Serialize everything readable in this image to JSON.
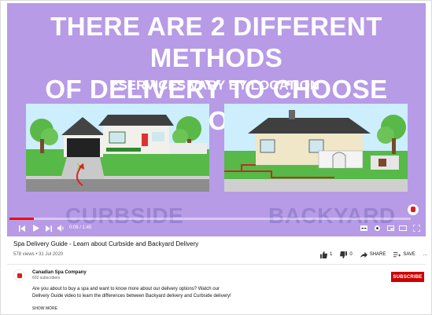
{
  "player": {
    "headline_line1": "THERE ARE 2 DIFFERENT METHODS",
    "headline_line2": "OF DELIVERY TO CHOOSE FROM:",
    "subline": "*SERVICES VARY BY LOCATION",
    "caption_left": "CURBSIDE",
    "caption_right": "BACKYARD",
    "progress_percent": 6,
    "time": "0:06 / 1:45",
    "colors": {
      "background": "#b79be6",
      "progress": "#ff0000"
    },
    "icons": [
      "previous-icon",
      "play-icon",
      "next-icon",
      "volume-icon",
      "subtitles-icon",
      "settings-icon",
      "miniplayer-icon",
      "theater-icon",
      "fullscreen-icon"
    ]
  },
  "video": {
    "title": "Spa Delivery Guide - Learn about Curbside and Backyard Delivery",
    "meta": "578 views • 31 Jul 2020",
    "likes": "1",
    "dislikes": "0",
    "share_label": "SHARE",
    "save_label": "SAVE",
    "more_label": "..."
  },
  "channel": {
    "name": "Canadian Spa Company",
    "subscribers": "602 subscribers",
    "subscribe_label": "SUBSCRIBE",
    "description": "Are you about to buy a spa and want to know more about our delivery options? Watch our Delivery Guide video to learn the differences between Backyard delivery and Curbside delivery!",
    "show_more": "SHOW MORE",
    "colors": {
      "subscribe": "#cc0000"
    }
  }
}
